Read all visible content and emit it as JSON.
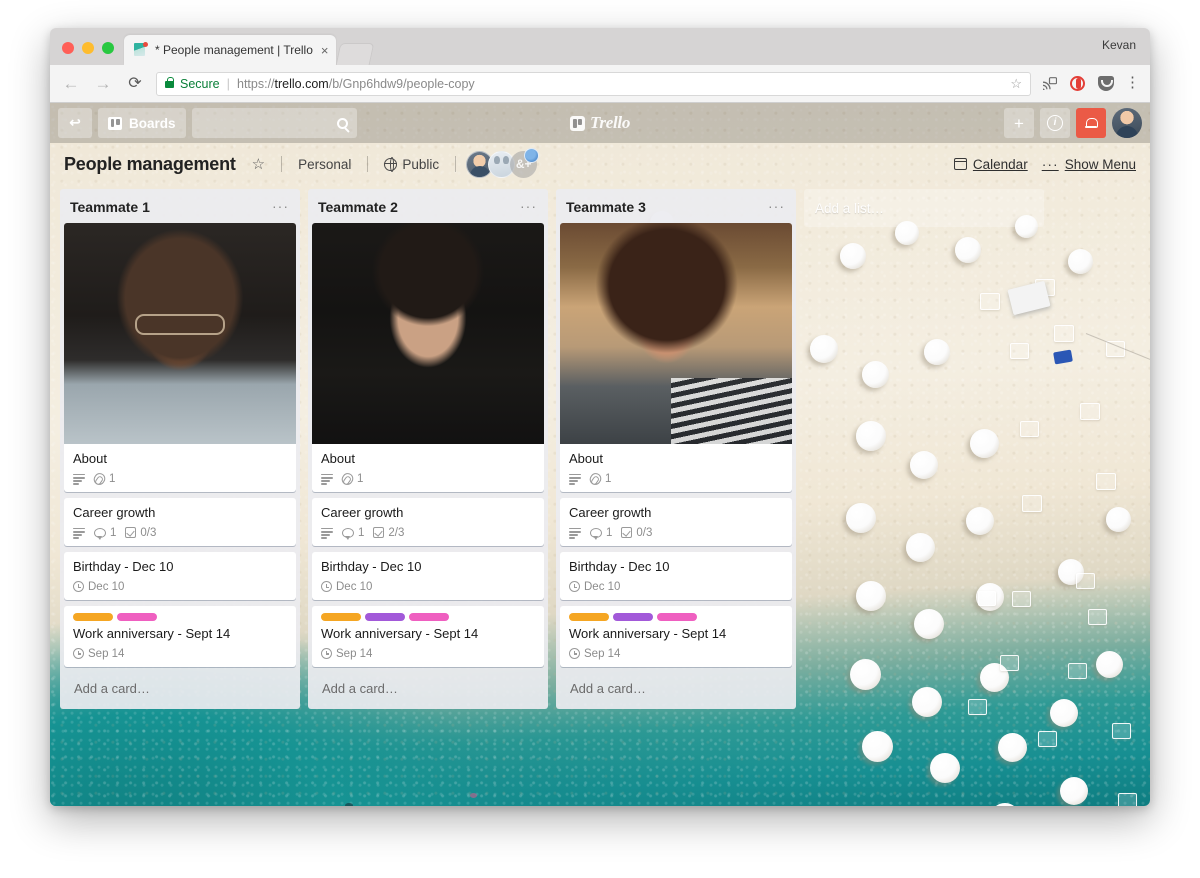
{
  "browser": {
    "tab": {
      "title": "* People management | Trello",
      "close_label": "×"
    },
    "profile_name": "Kevan",
    "back_icon": "←",
    "forward_icon": "→",
    "reload_icon": "⟳",
    "secure_label": "Secure",
    "url_sep": "|",
    "url_scheme": "https://",
    "url_host": "trello.com",
    "url_path": "/b/Gnp6hdw9/people-copy",
    "star_icon": "☆",
    "menu_icon": "⋮"
  },
  "trello_nav": {
    "back_icon": "↩",
    "boards_label": "Boards",
    "search_placeholder": "",
    "logo_text": "Trello",
    "add_label": "+",
    "info_label": "i"
  },
  "board_header": {
    "title": "People management",
    "star_icon": "☆",
    "team_label": "Personal",
    "visibility_label": "Public",
    "member_add_label": "&+",
    "calendar_label": "Calendar",
    "menu_dots": "···",
    "show_menu_label": "Show Menu"
  },
  "board": {
    "add_list_placeholder": "Add a list…",
    "label_colors": {
      "orange": "#f5a623",
      "purple": "#a259d9",
      "pink": "#ef5fc0"
    },
    "lists": [
      {
        "title": "Teammate 1",
        "menu": "···",
        "add_card": "Add a card…",
        "cards": [
          {
            "title": "About",
            "cover": "portrait-1",
            "labels": [],
            "badges": [
              {
                "icon": "description-icon",
                "text": ""
              },
              {
                "icon": "attachment-icon",
                "text": "1"
              }
            ]
          },
          {
            "title": "Career growth",
            "cover": null,
            "labels": [],
            "badges": [
              {
                "icon": "description-icon",
                "text": ""
              },
              {
                "icon": "comment-icon",
                "text": "1"
              },
              {
                "icon": "checklist-icon",
                "text": "0/3"
              }
            ]
          },
          {
            "title": "Birthday - Dec 10",
            "cover": null,
            "labels": [],
            "badges": [
              {
                "icon": "due-date-icon",
                "text": "Dec 10"
              }
            ]
          },
          {
            "title": "Work anniversary - Sept 14",
            "cover": null,
            "labels": [
              "orange",
              "pink"
            ],
            "badges": [
              {
                "icon": "due-date-icon",
                "text": "Sep 14"
              }
            ]
          }
        ]
      },
      {
        "title": "Teammate 2",
        "menu": "···",
        "add_card": "Add a card…",
        "cards": [
          {
            "title": "About",
            "cover": "portrait-2",
            "labels": [],
            "badges": [
              {
                "icon": "description-icon",
                "text": ""
              },
              {
                "icon": "attachment-icon",
                "text": "1"
              }
            ]
          },
          {
            "title": "Career growth",
            "cover": null,
            "labels": [],
            "badges": [
              {
                "icon": "description-icon",
                "text": ""
              },
              {
                "icon": "comment-icon",
                "text": "1"
              },
              {
                "icon": "checklist-icon",
                "text": "2/3"
              }
            ]
          },
          {
            "title": "Birthday - Dec 10",
            "cover": null,
            "labels": [],
            "badges": [
              {
                "icon": "due-date-icon",
                "text": "Dec 10"
              }
            ]
          },
          {
            "title": "Work anniversary - Sept 14",
            "cover": null,
            "labels": [
              "orange",
              "purple",
              "pink"
            ],
            "badges": [
              {
                "icon": "due-date-icon",
                "text": "Sep 14"
              }
            ]
          }
        ]
      },
      {
        "title": "Teammate 3",
        "menu": "···",
        "add_card": "Add a card…",
        "cards": [
          {
            "title": "About",
            "cover": "portrait-3",
            "labels": [],
            "badges": [
              {
                "icon": "description-icon",
                "text": ""
              },
              {
                "icon": "attachment-icon",
                "text": "1"
              }
            ]
          },
          {
            "title": "Career growth",
            "cover": null,
            "labels": [],
            "badges": [
              {
                "icon": "description-icon",
                "text": ""
              },
              {
                "icon": "comment-icon",
                "text": "1"
              },
              {
                "icon": "checklist-icon",
                "text": "0/3"
              }
            ]
          },
          {
            "title": "Birthday - Dec 10",
            "cover": null,
            "labels": [],
            "badges": [
              {
                "icon": "due-date-icon",
                "text": "Dec 10"
              }
            ]
          },
          {
            "title": "Work anniversary - Sept 14",
            "cover": null,
            "labels": [
              "orange",
              "purple",
              "pink"
            ],
            "badges": [
              {
                "icon": "due-date-icon",
                "text": "Sep 14"
              }
            ]
          }
        ]
      }
    ]
  }
}
